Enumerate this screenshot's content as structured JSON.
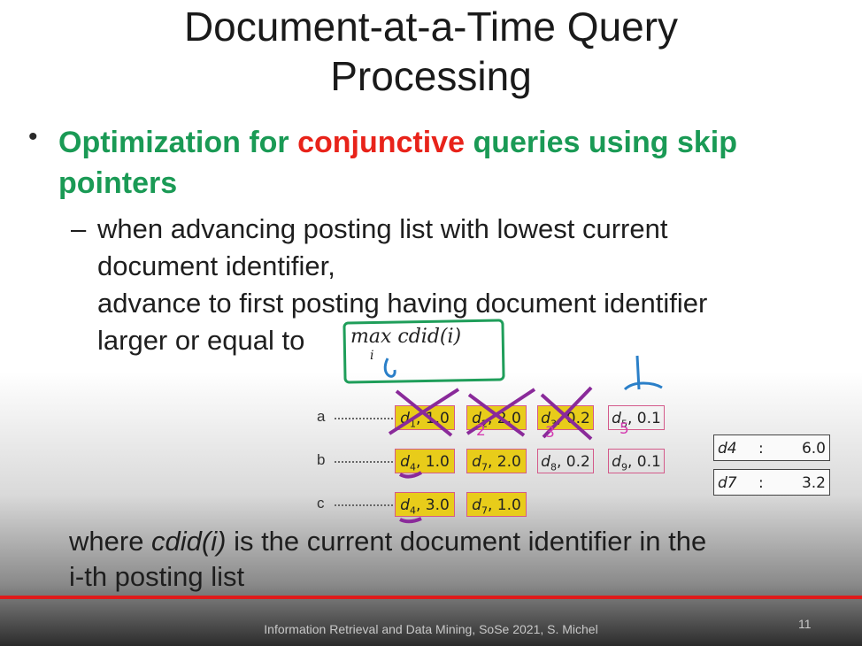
{
  "slide": {
    "title_line1": "Document-at-a-Time Query",
    "title_line2": "Processing",
    "bullet": {
      "part1": "Optimization for ",
      "part2": "conjunctive",
      "part3": " queries using skip",
      "part4": "pointers"
    },
    "sub_bullet": {
      "dash": "–",
      "line1": "when advancing posting list with lowest current",
      "line2": "document identifier,",
      "line3": "advance to first posting having document identifier",
      "line4": "larger or equal to"
    },
    "formula": {
      "op": "max",
      "subscript": "i",
      "expr": "cdid(i)"
    },
    "posting_lists": [
      {
        "label": "a",
        "postings": [
          {
            "doc": "d",
            "docsub": "1",
            "score": "1.0",
            "highlight": true
          },
          {
            "doc": "d",
            "docsub": "2",
            "score": "2.0",
            "highlight": true
          },
          {
            "doc": "d",
            "docsub": "3",
            "score": "0.2",
            "highlight": true
          },
          {
            "doc": "d",
            "docsub": "5",
            "score": "0.1",
            "highlight": false
          }
        ]
      },
      {
        "label": "b",
        "postings": [
          {
            "doc": "d",
            "docsub": "4",
            "score": "1.0",
            "highlight": true
          },
          {
            "doc": "d",
            "docsub": "7",
            "score": "2.0",
            "highlight": true
          },
          {
            "doc": "d",
            "docsub": "8",
            "score": "0.2",
            "highlight": false
          },
          {
            "doc": "d",
            "docsub": "9",
            "score": "0.1",
            "highlight": false
          }
        ]
      },
      {
        "label": "c",
        "postings": [
          {
            "doc": "d",
            "docsub": "4",
            "score": "3.0",
            "highlight": true
          },
          {
            "doc": "d",
            "docsub": "7",
            "score": "1.0",
            "highlight": true
          }
        ]
      }
    ],
    "accumulators": [
      {
        "doc": "d4",
        "colon": ":",
        "value": "6.0"
      },
      {
        "doc": "d7",
        "colon": ":",
        "value": "3.2"
      }
    ],
    "where_line1_a": "where ",
    "where_line1_b": "cdid(i)",
    "where_line1_c": " is the current document identifier in the",
    "where_line2": "i-th posting list",
    "footer": "Information Retrieval and Data Mining, SoSe 2021, S. Michel",
    "page_number": "11",
    "colors": {
      "green": "#1a9a55",
      "red": "#e8231a",
      "highlight": "#e8cc1a",
      "pen_purple": "#8a2a9a",
      "pen_blue": "#2a7fc8"
    }
  }
}
